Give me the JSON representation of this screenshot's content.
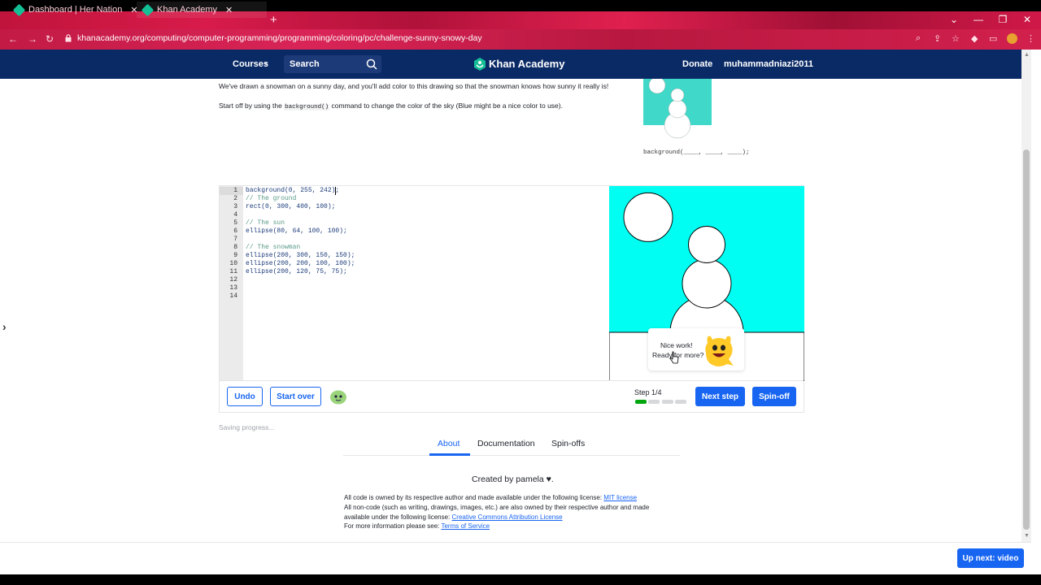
{
  "browser": {
    "tabs": [
      {
        "label": "Dashboard | Her Nation"
      },
      {
        "label": "Khan Academy"
      }
    ],
    "new_tab": "+",
    "url": "khanacademy.org/computing/computer-programming/programming/coloring/pc/challenge-sunny-snowy-day",
    "window_controls": {
      "minimize": "—",
      "restore": "❐",
      "close": "✕",
      "dropdown": "⌄"
    }
  },
  "header": {
    "courses": "Courses",
    "search_placeholder": "Search",
    "logo": "Khan Academy",
    "donate": "Donate",
    "username": "muhammadniazi2011"
  },
  "instructions": {
    "line1": "We've drawn a snowman on a sunny day, and you'll add color to this drawing so that the snowman knows how sunny it really is!",
    "line2_pre": "Start off by using the ",
    "line2_code": "background()",
    "line2_post": " command to change the color of the sky (Blue might be a nice color to use).",
    "hint_code": "background(____, ____, ____);"
  },
  "editor": {
    "lines": [
      {
        "n": "1",
        "text": "background(0, 255, 242);",
        "kind": "code"
      },
      {
        "n": "2",
        "text": "// The ground",
        "kind": "comment"
      },
      {
        "n": "3",
        "text": "rect(0, 300, 400, 100);",
        "kind": "code"
      },
      {
        "n": "4",
        "text": "",
        "kind": "code"
      },
      {
        "n": "5",
        "text": "// The sun",
        "kind": "comment"
      },
      {
        "n": "6",
        "text": "ellipse(80, 64, 100, 100);",
        "kind": "code"
      },
      {
        "n": "7",
        "text": "",
        "kind": "code"
      },
      {
        "n": "8",
        "text": "// The snowman",
        "kind": "comment"
      },
      {
        "n": "9",
        "text": "ellipse(200, 300, 150, 150);",
        "kind": "code"
      },
      {
        "n": "10",
        "text": "ellipse(200, 200, 100, 100);",
        "kind": "code"
      },
      {
        "n": "11",
        "text": "ellipse(200, 120, 75, 75);",
        "kind": "code"
      },
      {
        "n": "12",
        "text": "",
        "kind": "code"
      },
      {
        "n": "13",
        "text": "",
        "kind": "code"
      },
      {
        "n": "14",
        "text": "",
        "kind": "code"
      }
    ],
    "sky_color": "#00fff2"
  },
  "toolbar": {
    "undo": "Undo",
    "start_over": "Start over",
    "step": "Step 1/4",
    "step_progress": {
      "current": 1,
      "total": 4
    },
    "next_step": "Next step",
    "spin_off": "Spin-off"
  },
  "toast": {
    "line1": "Nice work!",
    "line2": "Ready for more?"
  },
  "saving": "Saving progress...",
  "page_tabs": {
    "about": "About",
    "documentation": "Documentation",
    "spinoffs": "Spin-offs"
  },
  "about": {
    "created_by": "Created by pamela",
    "heart": "♥",
    "lic1_pre": "All code is owned by its respective author and made available under the following license: ",
    "lic1_link": "MIT license",
    "lic2": "All non-code (such as writing, drawings, images, etc.) are also owned by their respective author and made",
    "lic3_pre": "available under the following license: ",
    "lic3_link": "Creative Commons Attribution License",
    "lic4_pre": "For more information please see: ",
    "lic4_link": "Terms of Service"
  },
  "up_next": "Up next: video",
  "colors": {
    "brand_blue": "#1865f2",
    "header_navy": "#0a2a66",
    "ka_green": "#14bf96",
    "progress_green": "#00a60e"
  }
}
